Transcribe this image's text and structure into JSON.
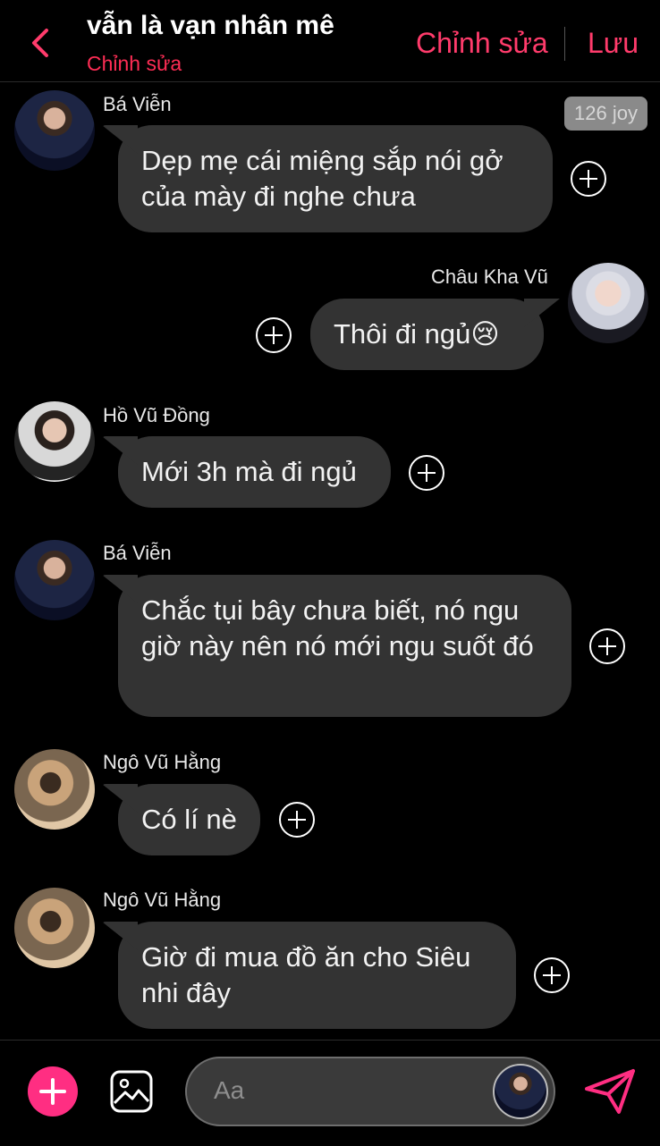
{
  "header": {
    "title": "vẫn là vạn nhân mê",
    "subtitle": "Chỉnh sửa",
    "edit_label": "Chỉnh sửa",
    "save_label": "Lưu"
  },
  "badge": "126 joy",
  "messages": [
    {
      "sender": "Bá Viễn",
      "text": "Dẹp mẹ cái miệng sắp nói gở của mày đi nghe chưa"
    },
    {
      "sender": "Châu Kha Vũ",
      "text": "Thôi đi ngủ😢"
    },
    {
      "sender": "Hồ Vũ Đồng",
      "text": "Mới 3h mà đi ngủ"
    },
    {
      "sender": "Bá Viễn",
      "text": "Chắc tụi bây chưa biết, nó ngu giờ này nên nó mới ngu suốt đó"
    },
    {
      "sender": "Ngô Vũ Hằng",
      "text": "Có lí nè"
    },
    {
      "sender": "Ngô Vũ Hằng",
      "text": "Giờ đi mua đồ ăn cho Siêu nhi đây"
    }
  ],
  "composer": {
    "placeholder": "Aa"
  },
  "colors": {
    "accent": "#ff3b6b",
    "bubble": "#333333",
    "add_button": "#ff2e82"
  }
}
